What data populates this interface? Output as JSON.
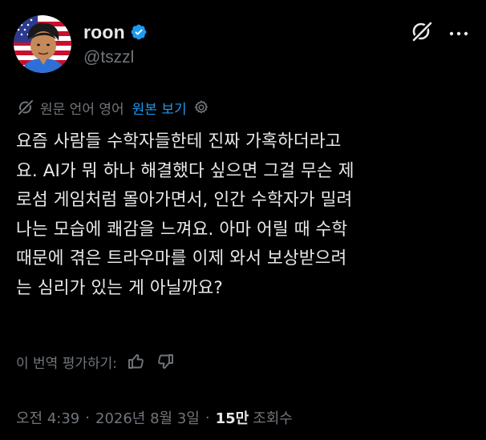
{
  "author": {
    "display_name": "roon",
    "handle": "@tszzl",
    "verified": true
  },
  "icons": {
    "verified": "verified-badge-icon",
    "grok": "grok-icon",
    "more": "more-icon",
    "translate": "translate-icon",
    "settings": "settings-gear-icon",
    "thumb_up": "thumbs-up-icon",
    "thumb_down": "thumbs-down-icon"
  },
  "colors": {
    "background": "#000000",
    "text": "#e7e9ea",
    "secondary": "#71767b",
    "accent": "#1d9bf0"
  },
  "translation": {
    "label": "원문 언어 영어",
    "show_original": "원본 보기"
  },
  "tweet": {
    "text": "요즘 사람들 수학자들한테 진짜 가혹하더라고\n요. AI가 뭐 하나 해결했다 싶으면 그걸 무슨 제\n로섬 게임처럼 몰아가면서, 인간 수학자가 밀려\n나는 모습에 쾌감을 느껴요. 아마 어릴 때 수학\n때문에 겪은 트라우마를 이제 와서 보상받으려\n는 심리가 있는 게 아닐까요?"
  },
  "rate": {
    "label": "이 번역 평가하기:"
  },
  "meta": {
    "time": "오전 4:39",
    "separator": "·",
    "date": "2026년 8월 3일",
    "views_count": "15만",
    "views_label": "조회수"
  }
}
